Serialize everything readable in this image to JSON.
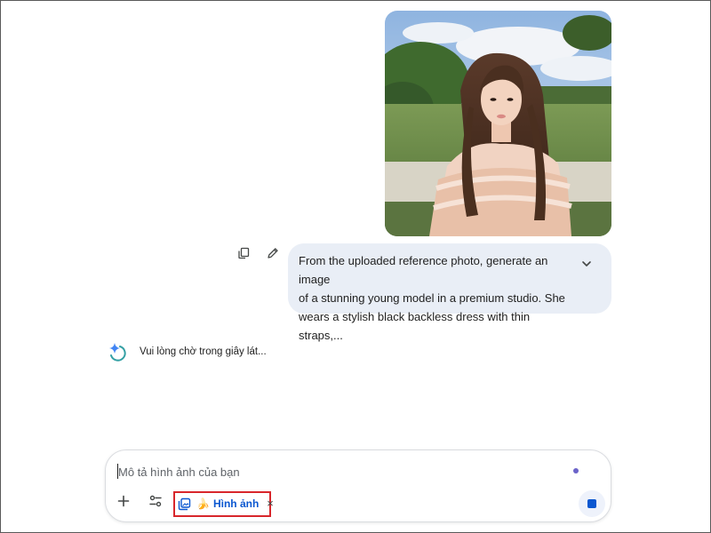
{
  "conversation": {
    "user_message": {
      "image_alt": "Uploaded reference photo of a woman with long hair in a ruffled floral top, standing in a green field with a white fence",
      "prompt_text": "From the uploaded reference photo, generate an image\nof a stunning young model in a premium studio. She\nwears a stylish black backless dress with thin straps,...",
      "actions": {
        "copy_icon": "copy-icon",
        "edit_icon": "pencil-icon",
        "expand_icon": "chevron-down-icon"
      }
    },
    "assistant": {
      "status_text": "Vui lòng chờ trong giây lát...",
      "icon": "gemini-spark-icon"
    }
  },
  "composer": {
    "placeholder": "Mô tả hình ảnh của bạn",
    "value": "",
    "add_icon": "plus-icon",
    "tools_icon": "tools-icon",
    "chip": {
      "icon": "image-gallery-icon",
      "emoji": "🍌",
      "label": "Hình ảnh",
      "close_symbol": "×"
    },
    "stop_icon": "stop-icon"
  },
  "colors": {
    "bubble_bg": "#e9eef6",
    "accent_blue": "#0b57d0",
    "highlight_red": "#d8262b",
    "status_dot": "#6b63c9"
  }
}
